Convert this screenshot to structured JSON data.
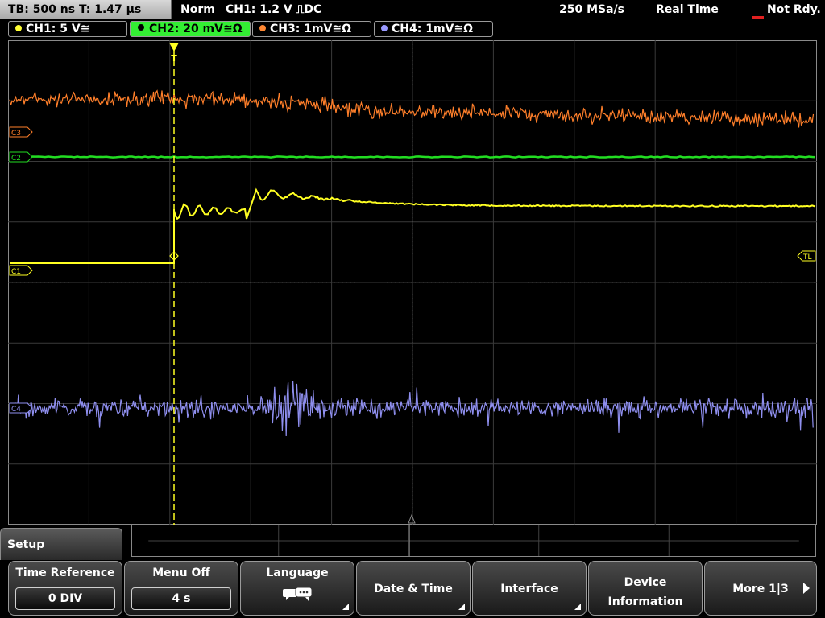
{
  "status": {
    "timebase": "TB: 500 ns   T: 1.47 µs",
    "mode": "Norm",
    "trigger": "CH1: 1.2 V ⎍DC",
    "sample_rate": "250 MSa/s",
    "acq_mode": "Real Time",
    "ready": "Not Rdy."
  },
  "channels": [
    {
      "label": "CH1: 5 V≅",
      "color": "#ffff33",
      "active": false
    },
    {
      "label": "CH2: 20 mV≅Ω",
      "color": "#33ee33",
      "active": true
    },
    {
      "label": "CH3: 1mV≅Ω",
      "color": "#ff8833",
      "active": false
    },
    {
      "label": "CH4: 1mV≅Ω",
      "color": "#9999ff",
      "active": false
    }
  ],
  "markers": {
    "c3": "C3",
    "c2": "C2",
    "c1": "C1",
    "c4": "C4",
    "tl": "TL",
    "trigger_t": "T"
  },
  "menu": {
    "title": "Setup",
    "softkeys": [
      {
        "label": "Time Reference",
        "value": "0 DIV"
      },
      {
        "label": "Menu Off",
        "value": "4 s"
      },
      {
        "label": "Language",
        "icon": "speech-bubbles-icon"
      },
      {
        "label": "Date & Time"
      },
      {
        "label": "Interface"
      },
      {
        "label1": "Device",
        "label2": "Information"
      },
      {
        "label": "More 1|3"
      }
    ]
  }
}
